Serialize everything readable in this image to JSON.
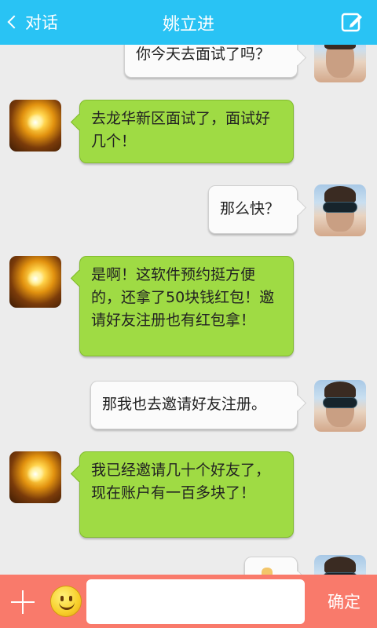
{
  "header": {
    "back_label": "对话",
    "title": "姚立进"
  },
  "messages": [
    {
      "side": "right",
      "text": "你今天去面试了吗？"
    },
    {
      "side": "left",
      "text": "去龙华新区面试了，面试好几个！"
    },
    {
      "side": "right",
      "text": "那么快？"
    },
    {
      "side": "left",
      "text": "是啊！这软件预约挺方便的，还拿了50块钱红包！邀请好友注册也有红包拿！"
    },
    {
      "side": "right",
      "text": "那我也去邀请好友注册。"
    },
    {
      "side": "left",
      "text": "我已经邀请几十个好友了，现在账户有一百多块了！"
    },
    {
      "side": "right",
      "text": ""
    }
  ],
  "input": {
    "value": "",
    "confirm_label": "确定"
  },
  "colors": {
    "header_bg": "#29c3f4",
    "bottom_bar_bg": "#f97a6b",
    "left_bubble": "#9fdb44",
    "right_bubble": "#fbfbfb"
  }
}
